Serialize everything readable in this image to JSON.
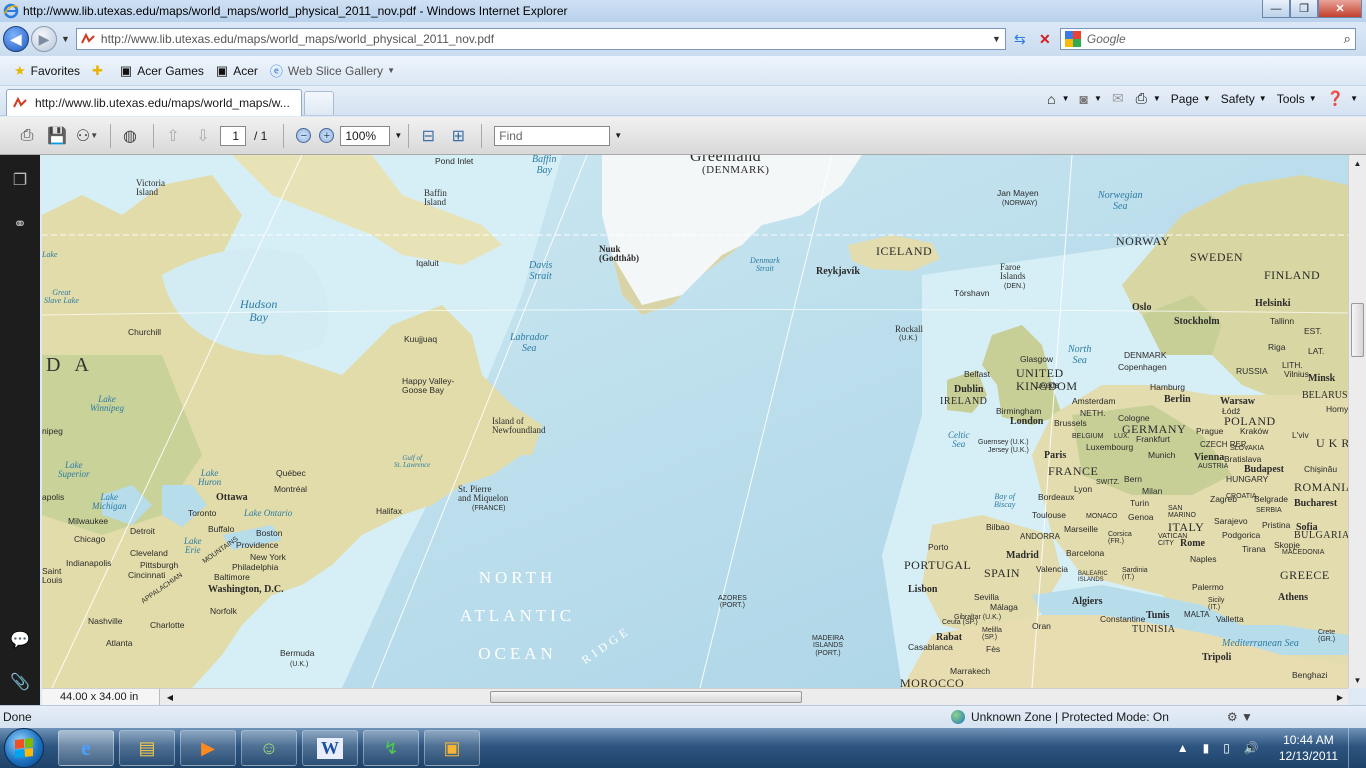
{
  "window": {
    "title": "http://www.lib.utexas.edu/maps/world_maps/world_physical_2011_nov.pdf - Windows Internet Explorer",
    "minimize": "—",
    "maximize": "❐",
    "close": "✕"
  },
  "address": {
    "url": "http://www.lib.utexas.edu/maps/world_maps/world_physical_2011_nov.pdf",
    "search_placeholder": "Google"
  },
  "favorites": {
    "label": "Favorites",
    "items": [
      "Acer Games",
      "Acer",
      "Web Slice Gallery"
    ]
  },
  "tab": {
    "label": "http://www.lib.utexas.edu/maps/world_maps/w..."
  },
  "commands": {
    "page": "Page",
    "safety": "Safety",
    "tools": "Tools"
  },
  "pdf_toolbar": {
    "page_current": "1",
    "page_total": "/ 1",
    "zoom": "100%",
    "find_placeholder": "Find"
  },
  "document": {
    "page_size": "44.00 x 34.00 in"
  },
  "map": {
    "labels": {
      "greenland": "Greenland",
      "denmark": "(DENMARK)",
      "victoria_island": "Victoria\nIsland",
      "pond_inlet": "Pond Inlet",
      "baffin_bay": "Baffin\nBay",
      "baffin_island": "Baffin\nIsland",
      "jan_mayen": "Jan Mayen",
      "jan_mayen_sub": "(NORWAY)",
      "norwegian_sea": "Norwegian\nSea",
      "norway": "NORWAY",
      "sweden": "SWEDEN",
      "finland": "FINLAND",
      "nuuk": "Nuuk\n(Godthåb)",
      "iceland": "ICELAND",
      "reykjavik": "Reykjavík",
      "davis_strait": "Davis\nStrait",
      "denmark_strait": "Denmark\nStrait",
      "faroe": "Faroe\nIslands",
      "faroe_sub": "(DEN.)",
      "torshavn": "Tórshavn",
      "iqaluit": "Iqaluit",
      "hudson_bay": "Hudson\nBay",
      "churchill": "Churchill",
      "kuujjuaq": "Kuujjuaq",
      "labrador_sea": "Labrador\nSea",
      "rockall": "Rockall",
      "rockall_sub": "(U.K.)",
      "north_sea": "North\nSea",
      "oslo": "Oslo",
      "stockholm": "Stockholm",
      "helsinki": "Helsinki",
      "tallinn": "Tallinn",
      "est": "EST.",
      "lat": "LAT.",
      "riga": "Riga",
      "lith": "LITH.",
      "vilnius": "Vilnius",
      "minsk": "Minsk",
      "belarus": "BELARUS",
      "russia": "RUSSIA",
      "canada_fragment": "D A",
      "happy_valley": "Happy Valley-\nGoose Bay",
      "glasgow": "Glasgow",
      "united_kingdom": "UNITED\nKINGDOM",
      "belfast": "Belfast",
      "leeds": "Leeds",
      "dublin": "Dublin",
      "ireland": "IRELAND",
      "birmingham": "Birmingham",
      "london": "London",
      "denmark_country": "DENMARK",
      "copenhagen": "Copenhagen",
      "hamburg": "Hamburg",
      "berlin": "Berlin",
      "warsaw": "Warsaw",
      "lodz": "Łódź",
      "poland": "POLAND",
      "amsterdam": "Amsterdam",
      "neth": "NETH.",
      "germany": "GERMANY",
      "lake_winnipeg": "Lake\nWinnipeg",
      "island_newfoundland": "Island of\nNewfoundland",
      "brussels": "Brussels",
      "belgium": "BELGIUM",
      "lux": "LUX.",
      "luxembourg": "Luxembourg",
      "cologne": "Cologne",
      "frankfurt": "Frankfurt",
      "prague": "Prague",
      "czech": "CZECH REP.",
      "krakow": "Kraków",
      "lviv": "L'viv",
      "ukr": "U K R",
      "quebec": "Québec",
      "montreal": "Montréal",
      "ottawa": "Ottawa",
      "lake_huron": "Lake\nHuron",
      "lake_superior": "Lake\nSuperior",
      "gulf_st_lawrence": "Gulf of\nSt. Lawrence",
      "celtic_sea": "Celtic\nSea",
      "guernsey": "Guernsey (U.K.)",
      "jersey": "Jersey (U.K.)",
      "paris": "Paris",
      "france": "FRANCE",
      "munich": "Munich",
      "vienna": "Vienna",
      "austria": "AUSTRIA",
      "bratislava": "Bratislava",
      "slovakia": "SLOVAKIA",
      "budapest": "Budapest",
      "hungary": "HUNGARY",
      "chisinau": "Chişinău",
      "romania": "ROMANIA",
      "st_pierre": "St. Pierre\nand Miquelon",
      "st_pierre_sub": "(FRANCE)",
      "halifax": "Halifax",
      "lake_michigan": "Lake\nMichigan",
      "toronto": "Toronto",
      "lake_ontario": "Lake Ontario",
      "buffalo": "Buffalo",
      "boston": "Boston",
      "milwaukee": "Milwaukee",
      "detroit": "Detroit",
      "chicago": "Chicago",
      "lake_erie": "Lake\nErie",
      "cleveland": "Cleveland",
      "providence": "Providence",
      "new_york": "New York",
      "bay_biscay": "Bay of\nBiscay",
      "bordeaux": "Bordeaux",
      "lyon": "Lyon",
      "switz": "SWITZ.",
      "bern": "Bern",
      "milan": "Milan",
      "turin": "Turin",
      "toulouse": "Toulouse",
      "monaco": "MONACO",
      "genoa": "Genoa",
      "marseille": "Marseille",
      "san_marino": "SAN\nMARINO",
      "zagreb": "Zagreb",
      "croatia": "CROATIA",
      "belgrade": "Belgrade",
      "serbia": "SERBIA",
      "bucharest": "Bucharest",
      "sarajevo": "Sarajevo",
      "italy": "ITALY",
      "pristina": "Pristina",
      "sofia": "Sofia",
      "bulgaria": "BULGARIA",
      "podgorica": "Podgorica",
      "skopje": "Skopje",
      "macedonia": "MACEDONIA",
      "tirana": "Tirana",
      "bilbao": "Bilbao",
      "andorra": "ANDORRA",
      "barcelona": "Barcelona",
      "corsica": "Corsica\n(FR.)",
      "vatican": "VATICAN\nCITY",
      "rome": "Rome",
      "sardinia": "Sardinia\n(IT.)",
      "naples": "Naples",
      "greece": "GREECE",
      "athens": "Athens",
      "porto": "Porto",
      "portugal": "PORTUGAL",
      "madrid": "Madrid",
      "spain": "SPAIN",
      "valencia": "Valencia",
      "balearic": "BALEARIC\nISLANDS",
      "palermo": "Palermo",
      "sicily": "Sicily\n(IT.)",
      "lisbon": "Lisbon",
      "sevilla": "Sevilla",
      "malaga": "Málaga",
      "gibraltar": "Gibraltar (U.K.)",
      "algiers": "Algiers",
      "constantine": "Constantine",
      "tunis": "Tunis",
      "tunisia": "TUNISIA",
      "malta": "MALTA",
      "valletta": "Valletta",
      "ceuta": "Ceuta (SP.)",
      "melilla": "Melilla\n(SP.)",
      "oran": "Oran",
      "mediterranean": "Mediterranean Sea",
      "crete": "Crete\n(GR.)",
      "rabat": "Rabat",
      "casablanca": "Casablanca",
      "fes": "Fès",
      "marrakech": "Marrakech",
      "morocco": "MOROCCO",
      "tripoli": "Tripoli",
      "benghazi": "Benghazi",
      "indianapolis": "Indianapolis",
      "pittsburgh": "Pittsburgh",
      "cincinnati": "Cincinnati",
      "philadelphia": "Philadelphia",
      "baltimore": "Baltimore",
      "washington": "Washington, D.C.",
      "norfolk": "Norfolk",
      "nashville": "Nashville",
      "charlotte": "Charlotte",
      "atlanta": "Atlanta",
      "appalachian": "APPALACHIAN",
      "mountains": "MOUNTAINS",
      "north_atlantic": "NORTH\nATLANTIC\nOCEAN",
      "ridge": "RIDGE",
      "azores": "AZORES\n(PORT.)",
      "madeira": "MADEIRA\nISLANDS\n(PORT.)",
      "bermuda": "Bermuda",
      "bermuda_sub": "(U.K.)",
      "great_slave": "Great\nSlave Lake",
      "lake_left": "Lake",
      "nipeg": "nipeg",
      "apolis": "apolis",
      "saint_louis": "Saint\nLouis",
      "homyl": "Homyl"
    }
  },
  "status": {
    "text": "Done",
    "zone": "Unknown Zone | Protected Mode: On"
  },
  "taskbar": {
    "time": "10:44 AM",
    "date": "12/13/2011"
  },
  "colors": {
    "ocean": "#b7dcea",
    "ocean_shelf": "#d3ecf3",
    "land": "#e3dcae",
    "land_green": "#c7cf97",
    "ice": "#f5f9fb"
  }
}
